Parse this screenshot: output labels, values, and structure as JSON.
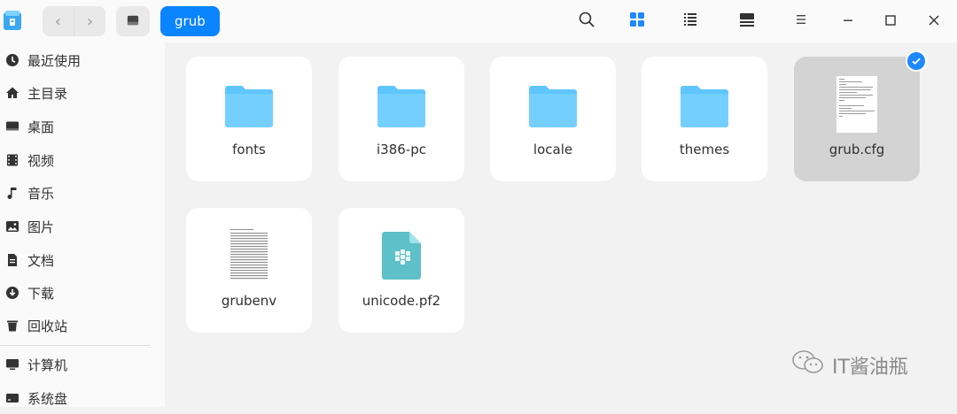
{
  "breadcrumb": {
    "current": "grub"
  },
  "sidebar": {
    "items": [
      {
        "label": "最近使用",
        "icon": "clock-icon"
      },
      {
        "label": "主目录",
        "icon": "home-icon"
      },
      {
        "label": "桌面",
        "icon": "desktop-icon"
      },
      {
        "label": "视频",
        "icon": "video-icon"
      },
      {
        "label": "音乐",
        "icon": "music-icon"
      },
      {
        "label": "图片",
        "icon": "image-icon"
      },
      {
        "label": "文档",
        "icon": "document-icon"
      },
      {
        "label": "下载",
        "icon": "download-icon"
      },
      {
        "label": "回收站",
        "icon": "trash-icon"
      },
      {
        "label": "计算机",
        "icon": "computer-icon"
      },
      {
        "label": "系统盘",
        "icon": "disk-icon"
      }
    ]
  },
  "toolbar": {
    "icons": [
      "search-icon",
      "icon-view-icon",
      "list-view-icon",
      "detail-view-icon",
      "menu-icon",
      "minimize-icon",
      "maximize-icon",
      "close-icon"
    ]
  },
  "files": [
    {
      "name": "fonts",
      "type": "folder"
    },
    {
      "name": "i386-pc",
      "type": "folder"
    },
    {
      "name": "locale",
      "type": "folder"
    },
    {
      "name": "themes",
      "type": "folder"
    },
    {
      "name": "grub.cfg",
      "type": "text",
      "selected": true
    },
    {
      "name": "grubenv",
      "type": "text"
    },
    {
      "name": "unicode.pf2",
      "type": "font"
    }
  ],
  "watermark": {
    "text": "IT酱油瓶"
  },
  "colors": {
    "accent": "#0a84ff",
    "folder": "#5ec5ff",
    "font_file": "#5ec0c8"
  }
}
